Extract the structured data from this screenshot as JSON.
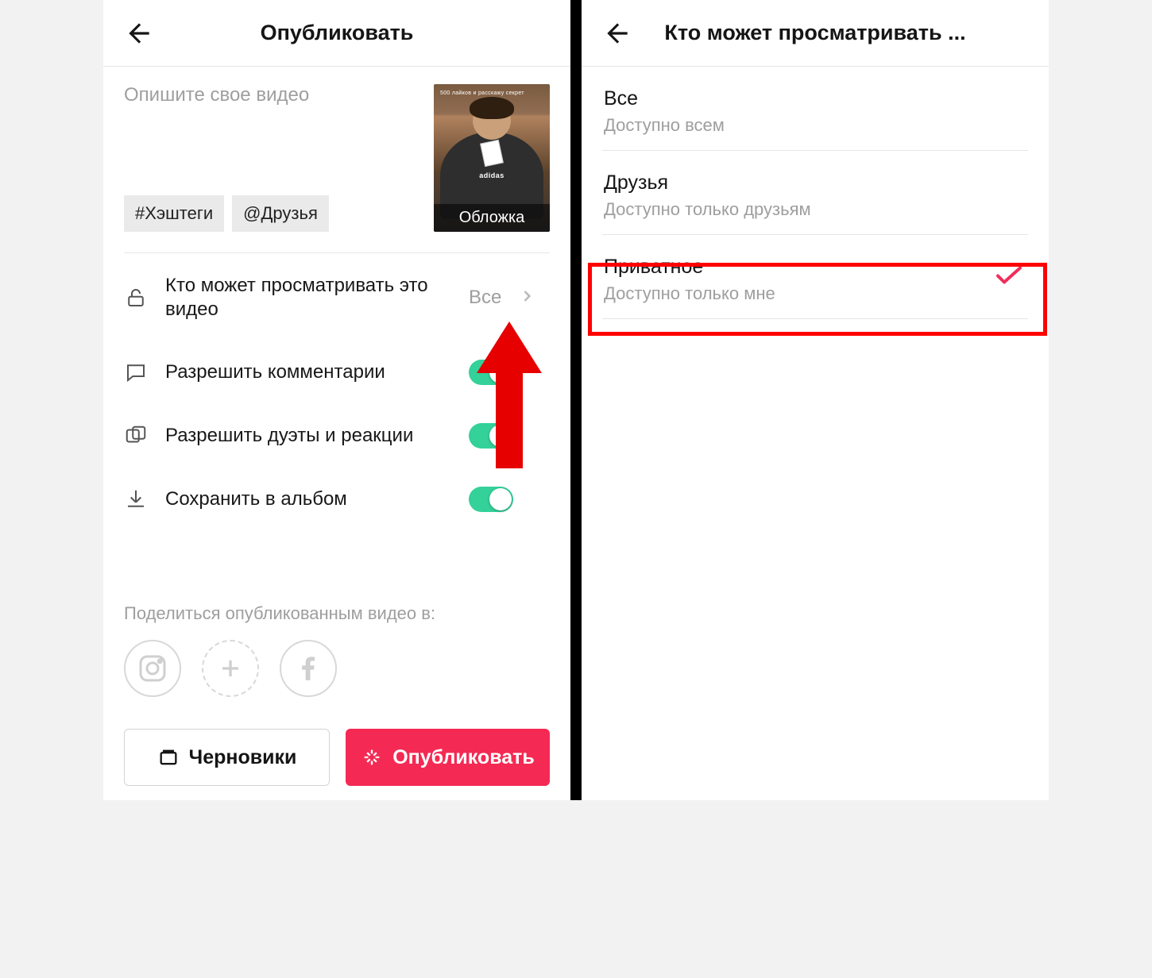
{
  "left": {
    "header_title": "Опубликовать",
    "caption_placeholder": "Опишите свое видео",
    "chip_hashtags": "#Хэштеги",
    "chip_friends": "@Друзья",
    "thumb_overlay_text": "500 лайков и расскажу секрет",
    "thumb_brand": "adidas",
    "cover_label": "Обложка",
    "settings": {
      "who_can_view": {
        "label": "Кто может просматривать это видео",
        "value": "Все"
      },
      "allow_comments": {
        "label": "Разрешить комментарии"
      },
      "allow_duets": {
        "label": "Разрешить дуэты и реакции"
      },
      "save_to_album": {
        "label": "Сохранить в альбом"
      }
    },
    "share_label": "Поделиться опубликованным видео в:",
    "drafts_button": "Черновики",
    "publish_button": "Опубликовать"
  },
  "right": {
    "header_title": "Кто может просматривать ...",
    "options": [
      {
        "title": "Все",
        "subtitle": "Доступно всем",
        "selected": false
      },
      {
        "title": "Друзья",
        "subtitle": "Доступно только друзьям",
        "selected": false
      },
      {
        "title": "Приватное",
        "subtitle": "Доступно только мне",
        "selected": true
      }
    ]
  }
}
